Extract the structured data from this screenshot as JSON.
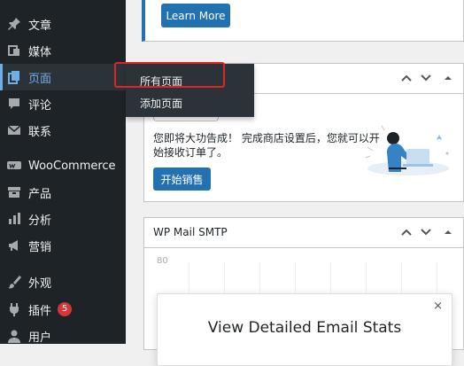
{
  "sidebar": {
    "items": [
      {
        "label": "文章",
        "icon": "pin-icon"
      },
      {
        "label": "媒体",
        "icon": "media-icon"
      },
      {
        "label": "页面",
        "icon": "page-icon"
      },
      {
        "label": "评论",
        "icon": "comment-icon"
      },
      {
        "label": "联系",
        "icon": "mail-icon"
      },
      {
        "label": "WooCommerce",
        "icon": "woo-icon"
      },
      {
        "label": "产品",
        "icon": "archive-icon"
      },
      {
        "label": "分析",
        "icon": "bar-chart-icon"
      },
      {
        "label": "营销",
        "icon": "megaphone-icon"
      },
      {
        "label": "外观",
        "icon": "brush-icon"
      },
      {
        "label": "插件",
        "icon": "plugin-icon",
        "badge": "5"
      },
      {
        "label": "用户",
        "icon": "user-icon"
      }
    ],
    "active_index": 2
  },
  "flyout": {
    "items": [
      "所有页面",
      "添加页面"
    ]
  },
  "top_panel": {
    "button_label": "Learn More"
  },
  "store_panel": {
    "text": "您即将大功告成！ 完成商店设置后，您就可以开始接收订单了。",
    "button_label": "开始销售"
  },
  "smtp_panel": {
    "title": "WP Mail SMTP",
    "axis_tick": "80"
  },
  "modal": {
    "title": "View Detailed Email Stats",
    "close": "×"
  },
  "colors": {
    "sidebar_bg": "#1d2327",
    "accent": "#2271b1",
    "active_text": "#72aee6",
    "badge": "#d63638",
    "highlight": "#e02424"
  }
}
